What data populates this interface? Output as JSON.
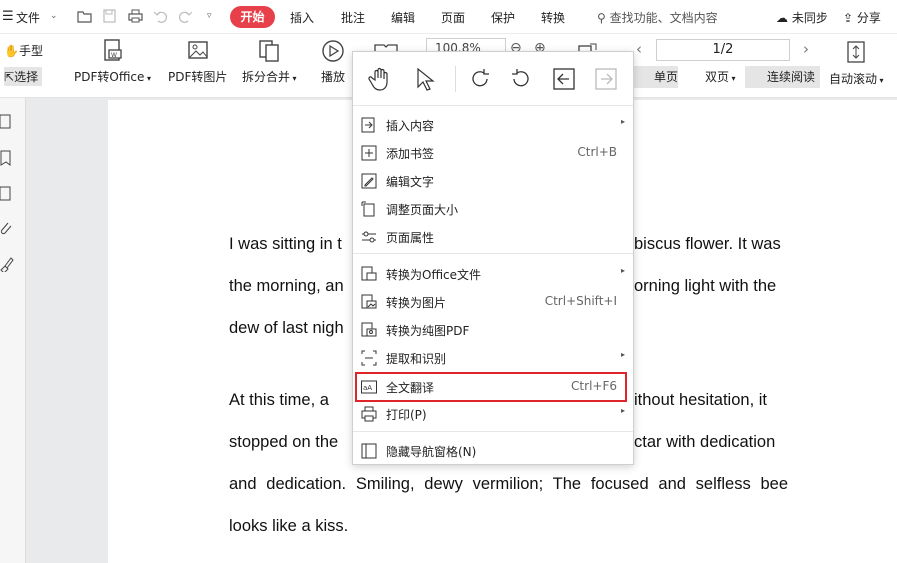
{
  "menubar": {
    "file_label": "文件",
    "tabs": [
      "插入",
      "批注",
      "编辑",
      "页面",
      "保护",
      "转换"
    ],
    "active_tab": "开始",
    "search_placeholder": "查找功能、文档内容",
    "sync_label": "未同步",
    "share_label": "分享"
  },
  "toolbar": {
    "hand_label": "手型",
    "select_label": "选择",
    "pdf_to_office": "PDF转Office",
    "pdf_to_image": "PDF转图片",
    "split_merge": "拆分合并",
    "play": "播放",
    "zoom": "100.8%",
    "page_indicator": "1/2",
    "single_page": "单页",
    "double_page": "双页",
    "continuous_read": "连续阅读",
    "auto_scroll": "自动滚动"
  },
  "document": {
    "paragraph1": [
      "I was sitting in t",
      "biscus flower. It was",
      "the morning, an",
      "orning light with the",
      "dew of last nigh"
    ],
    "paragraph2": [
      "At this time, a",
      "ithout hesitation, it",
      "stopped on the",
      "ctar with dedication",
      "and dedication. Smiling, dewy vermilion; The focused and selfless bee",
      "looks like a kiss."
    ]
  },
  "context_menu": {
    "top_icons": [
      "hand-tool-icon",
      "select-arrow-icon",
      "rotate-clockwise-icon",
      "rotate-counterclockwise-icon",
      "prev-page-icon",
      "next-page-icon"
    ],
    "items": [
      {
        "label": "插入内容",
        "shortcut": "",
        "submenu": true
      },
      {
        "label": "添加书签",
        "shortcut": "Ctrl+B",
        "submenu": false
      },
      {
        "label": "编辑文字",
        "shortcut": "",
        "submenu": false
      },
      {
        "label": "调整页面大小",
        "shortcut": "",
        "submenu": false
      },
      {
        "label": "页面属性",
        "shortcut": "",
        "submenu": false
      },
      {
        "label": "转换为Office文件",
        "shortcut": "",
        "submenu": true
      },
      {
        "label": "转换为图片",
        "shortcut": "Ctrl+Shift+I",
        "submenu": false
      },
      {
        "label": "转换为纯图PDF",
        "shortcut": "",
        "submenu": false
      },
      {
        "label": "提取和识别",
        "shortcut": "",
        "submenu": true
      },
      {
        "label": "全文翻译",
        "shortcut": "Ctrl+F6",
        "submenu": false,
        "highlighted": true
      },
      {
        "label": "打印(P)",
        "shortcut": "",
        "submenu": true
      },
      {
        "label": "隐藏导航窗格(N)",
        "shortcut": "",
        "submenu": false
      }
    ]
  },
  "colors": {
    "accent_red": "#e8404a",
    "highlight_border": "#e0242a"
  }
}
